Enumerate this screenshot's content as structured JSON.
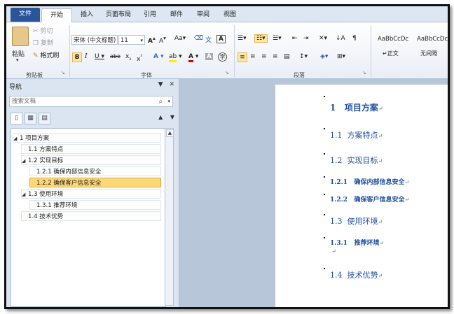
{
  "tabs": [
    "文件",
    "开始",
    "插入",
    "页面布局",
    "引用",
    "邮件",
    "审阅",
    "视图"
  ],
  "ribbon": {
    "paste_label": "粘贴",
    "cut_label": "剪切",
    "copy_label": "复制",
    "format_painter_label": "格式刷",
    "clipboard_group": "剪贴板",
    "font_name": "宋体 (中文标题)",
    "font_size": "11",
    "font_group": "字体",
    "paragraph_group": "段落",
    "style_normal_preview": "AaBbCcDc",
    "style_normal_label": "↵正文",
    "style_nospacing_preview": "AaBbCcDc",
    "style_nospacing_label": "无间隔"
  },
  "nav": {
    "title": "导航",
    "search_placeholder": "搜索文档",
    "tree": [
      {
        "label": "1 项目方案",
        "level": 0,
        "toggle": "◢"
      },
      {
        "label": "1.1 方案特点",
        "level": 1,
        "toggle": ""
      },
      {
        "label": "1.2 实现目标",
        "level": 1,
        "toggle": "◢"
      },
      {
        "label": "1.2.1 确保内部信息安全",
        "level": 2,
        "toggle": ""
      },
      {
        "label": "1.2.2 确保客户信息安全",
        "level": 2,
        "toggle": "",
        "selected": true
      },
      {
        "label": "1.3 使用环境",
        "level": 1,
        "toggle": "◢"
      },
      {
        "label": "1.3.1 推荐环境",
        "level": 2,
        "toggle": ""
      },
      {
        "label": "1.4 技术优势",
        "level": 1,
        "toggle": ""
      }
    ]
  },
  "document": {
    "headings": [
      {
        "num": "1",
        "text": "项目方案",
        "level": 1
      },
      {
        "num": "1.1",
        "text": "方案特点",
        "level": 2
      },
      {
        "num": "1.2",
        "text": "实现目标",
        "level": 2
      },
      {
        "num": "1.2.1",
        "text": "确保内部信息安全",
        "level": 3
      },
      {
        "num": "1.2.2",
        "text": "确保客户信息安全",
        "level": 3
      },
      {
        "num": "1.3",
        "text": "使用环境",
        "level": 2
      },
      {
        "num": "1.3.1",
        "text": "推荐环境",
        "level": 3
      },
      {
        "num": "1.4",
        "text": "技术优势",
        "level": 2
      }
    ],
    "para_mark": "↵"
  },
  "colors": {
    "file_tab": "#2a5699",
    "heading": "#1e4fa0",
    "selection": "#fcd876"
  }
}
